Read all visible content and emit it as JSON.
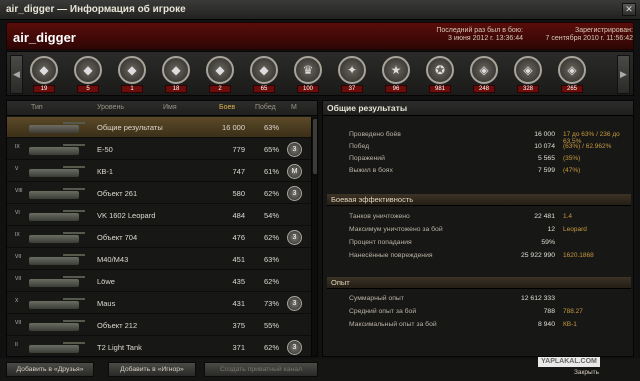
{
  "window": {
    "title": "air_digger — Информация об игроке",
    "close_glyph": "✕"
  },
  "header": {
    "player": "air_digger",
    "last_battle_label": "Последний раз был в бою:",
    "last_battle_value": "3 июня 2012 г. 13:36:44",
    "registered_label": "Зарегистрирован:",
    "registered_value": "7 сентября 2010 г. 11:56:42"
  },
  "medals": {
    "left_arrow": "◀",
    "right_arrow": "▶",
    "items": [
      {
        "icon": "tank-medal-icon",
        "glyph": "◆",
        "count": "19"
      },
      {
        "icon": "tank-medal-icon",
        "glyph": "◆",
        "count": "5"
      },
      {
        "icon": "tank-medal-icon",
        "glyph": "◆",
        "count": "1"
      },
      {
        "icon": "tank-medal-icon",
        "glyph": "◆",
        "count": "18"
      },
      {
        "icon": "tank-medal-icon",
        "glyph": "◆",
        "count": "2"
      },
      {
        "icon": "tank-medal-icon",
        "glyph": "◆",
        "count": "65"
      },
      {
        "icon": "shield-medal-icon",
        "glyph": "♛",
        "count": "100"
      },
      {
        "icon": "medal-icon",
        "glyph": "✦",
        "count": "37"
      },
      {
        "icon": "star-medal-icon",
        "glyph": "★",
        "count": "96"
      },
      {
        "icon": "medal-icon",
        "glyph": "✪",
        "count": "981"
      },
      {
        "icon": "shield-medal-icon",
        "glyph": "◈",
        "count": "248"
      },
      {
        "icon": "shield-medal-icon",
        "glyph": "◈",
        "count": "328"
      },
      {
        "icon": "shield-medal-icon",
        "glyph": "◈",
        "count": "265"
      }
    ]
  },
  "vehicles": {
    "headers": {
      "type": "Тип",
      "level": "Уровень",
      "name": "Имя",
      "battles": "Боев",
      "wins": "Побед",
      "mastery": "М"
    },
    "rows": [
      {
        "tier": "",
        "name": "Общие результаты",
        "battles": "16 000",
        "wins": "63%",
        "mastery": "",
        "selected": true
      },
      {
        "tier": "IX",
        "name": "E-50",
        "battles": "779",
        "wins": "65%",
        "mastery": "3"
      },
      {
        "tier": "V",
        "name": "КВ-1",
        "battles": "747",
        "wins": "61%",
        "mastery": "M"
      },
      {
        "tier": "VIII",
        "name": "Объект 261",
        "battles": "580",
        "wins": "62%",
        "mastery": "3"
      },
      {
        "tier": "VI",
        "name": "VK 1602 Leopard",
        "battles": "484",
        "wins": "54%",
        "mastery": ""
      },
      {
        "tier": "IX",
        "name": "Объект 704",
        "battles": "476",
        "wins": "62%",
        "mastery": "3"
      },
      {
        "tier": "VII",
        "name": "M40/M43",
        "battles": "451",
        "wins": "63%",
        "mastery": ""
      },
      {
        "tier": "VII",
        "name": "Löwe",
        "battles": "435",
        "wins": "62%",
        "mastery": ""
      },
      {
        "tier": "X",
        "name": "Maus",
        "battles": "431",
        "wins": "73%",
        "mastery": "3"
      },
      {
        "tier": "VII",
        "name": "Объект 212",
        "battles": "375",
        "wins": "55%",
        "mastery": ""
      },
      {
        "tier": "II",
        "name": "T2 Light Tank",
        "battles": "371",
        "wins": "62%",
        "mastery": "3"
      }
    ]
  },
  "summary": {
    "title": "Общие результаты",
    "general": [
      {
        "label": "Проведено боёв",
        "value": "16 000",
        "extra": "17 до 63% / 236 до 63.5%"
      },
      {
        "label": "Побед",
        "value": "10 074",
        "extra": "(63%) / 62.962%"
      },
      {
        "label": "Поражений",
        "value": "5 565",
        "extra": "(35%)"
      },
      {
        "label": "Выжил в боях",
        "value": "7 599",
        "extra": "(47%)"
      }
    ],
    "efficiency_title": "Боевая эффективность",
    "efficiency": [
      {
        "label": "Танков уничтожено",
        "value": "22 481",
        "extra": "1.4"
      },
      {
        "label": "Максимум уничтожено за бой",
        "value": "12",
        "extra": "Leopard"
      },
      {
        "label": "Процент попадания",
        "value": "59%",
        "extra": ""
      },
      {
        "label": "Нанесённые повреждения",
        "value": "25 922 990",
        "extra": "1620.1868"
      }
    ],
    "experience_title": "Опыт",
    "experience": [
      {
        "label": "Суммарный опыт",
        "value": "12 612 333",
        "extra": ""
      },
      {
        "label": "Средний опыт за бой",
        "value": "788",
        "extra": "788.27"
      },
      {
        "label": "Максимальный опыт за бой",
        "value": "8 940",
        "extra": "КВ-1"
      }
    ]
  },
  "footer": {
    "add_friends": "Добавить в «Друзья»",
    "add_ignore": "Добавить в «Игнор»",
    "private_channel": "Создать приватный канал",
    "close": "Закрыть",
    "watermark": "YAPLAKAL.COM"
  }
}
